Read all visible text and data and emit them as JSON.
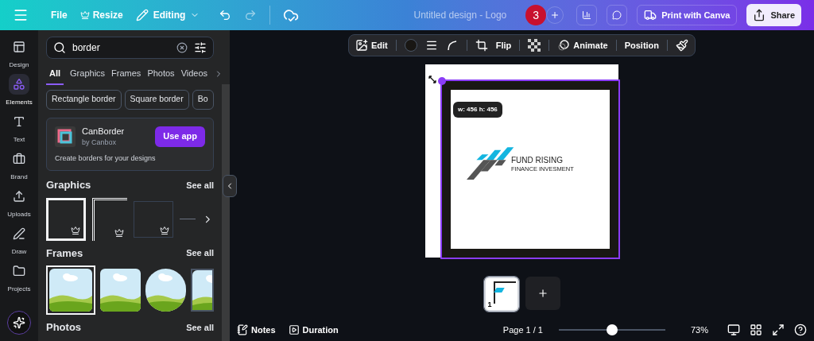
{
  "topbar": {
    "file": "File",
    "resize": "Resize",
    "editing": "Editing",
    "title": "Untitled design - Logo",
    "collaborators": "3",
    "print": "Print with Canva",
    "share": "Share"
  },
  "rail": [
    {
      "label": "Design",
      "selected": false
    },
    {
      "label": "Elements",
      "selected": true
    },
    {
      "label": "Text",
      "selected": false
    },
    {
      "label": "Brand",
      "selected": false
    },
    {
      "label": "Uploads",
      "selected": false
    },
    {
      "label": "Draw",
      "selected": false
    },
    {
      "label": "Projects",
      "selected": false
    }
  ],
  "panel": {
    "search": {
      "value": "border"
    },
    "tabs": [
      {
        "label": "All",
        "selected": true
      },
      {
        "label": "Graphics",
        "selected": false
      },
      {
        "label": "Frames",
        "selected": false
      },
      {
        "label": "Photos",
        "selected": false
      },
      {
        "label": "Videos",
        "selected": false
      }
    ],
    "chips": [
      "Rectangle border",
      "Square border",
      "Bo"
    ],
    "app": {
      "name": "CanBorder",
      "by": "by Canbox",
      "description": "Create borders for your designs",
      "button": "Use app"
    },
    "sections": [
      {
        "title": "Graphics",
        "link": "See all",
        "kind": "graphics"
      },
      {
        "title": "Frames",
        "link": "See all",
        "kind": "frames"
      },
      {
        "title": "Photos",
        "link": "See all",
        "kind": "photos"
      }
    ]
  },
  "toolbar": {
    "edit": "Edit",
    "flip": "Flip",
    "animate": "Animate",
    "position": "Position"
  },
  "canvas": {
    "size_tooltip": "w: 456 h: 456",
    "logo_title": "FUND RISING",
    "logo_subtitle": "FINANCE INVESMENT"
  },
  "pages": [
    {
      "number": "1",
      "selected": true
    }
  ],
  "bottom": {
    "notes": "Notes",
    "duration": "Duration",
    "page": "Page 1 / 1",
    "zoom": {
      "level": 0.5
    },
    "zoom_reading": "73%"
  }
}
